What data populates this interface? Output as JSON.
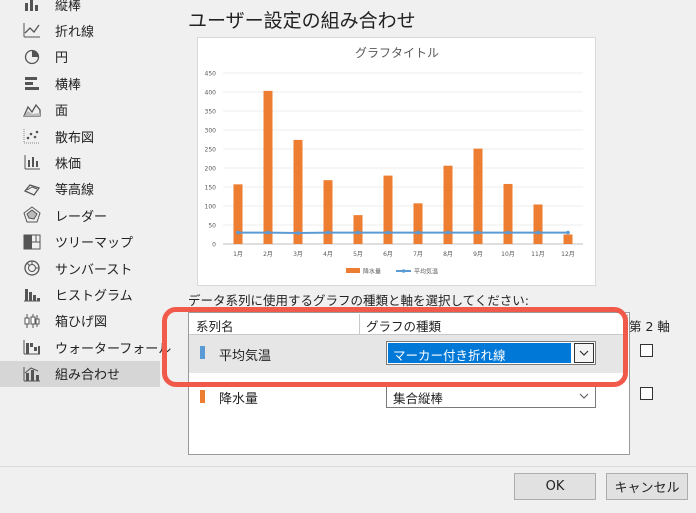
{
  "sidebar": {
    "items": [
      {
        "label": "縦棒",
        "icon": "column-chart-icon"
      },
      {
        "label": "折れ線",
        "icon": "line-chart-icon"
      },
      {
        "label": "円",
        "icon": "pie-chart-icon"
      },
      {
        "label": "横棒",
        "icon": "bar-chart-icon"
      },
      {
        "label": "面",
        "icon": "area-chart-icon"
      },
      {
        "label": "散布図",
        "icon": "scatter-chart-icon"
      },
      {
        "label": "株価",
        "icon": "stock-chart-icon"
      },
      {
        "label": "等高線",
        "icon": "surface-chart-icon"
      },
      {
        "label": "レーダー",
        "icon": "radar-chart-icon"
      },
      {
        "label": "ツリーマップ",
        "icon": "treemap-chart-icon"
      },
      {
        "label": "サンバースト",
        "icon": "sunburst-chart-icon"
      },
      {
        "label": "ヒストグラム",
        "icon": "histogram-chart-icon"
      },
      {
        "label": "箱ひげ図",
        "icon": "box-whisker-chart-icon"
      },
      {
        "label": "ウォーターフォール",
        "icon": "waterfall-chart-icon"
      },
      {
        "label": "組み合わせ",
        "icon": "combo-chart-icon",
        "selected": true
      }
    ]
  },
  "main": {
    "heading": "ユーザー設定の組み合わせ",
    "instruction": "データ系列に使用するグラフの種類と軸を選択してください:"
  },
  "chart_data": {
    "type": "bar",
    "title": "グラフタイトル",
    "categories": [
      "1月",
      "2月",
      "3月",
      "4月",
      "5月",
      "6月",
      "7月",
      "8月",
      "9月",
      "10月",
      "11月",
      "12月"
    ],
    "ylim": [
      0,
      450
    ],
    "yticks": [
      "0",
      "50",
      "100",
      "150",
      "200",
      "250",
      "300",
      "350",
      "400",
      "450"
    ],
    "legend_position": "bottom",
    "series": [
      {
        "name": "降水量",
        "type": "bar",
        "color": "#ed7d31",
        "values": [
          157,
          403,
          274,
          168,
          76,
          180,
          107,
          206,
          251,
          158,
          104,
          25
        ]
      },
      {
        "name": "平均気温",
        "type": "line-marker",
        "color": "#5b9bd5",
        "values": [
          30,
          30,
          29,
          30,
          30,
          30,
          30,
          30,
          30,
          30,
          30,
          30
        ]
      }
    ]
  },
  "table": {
    "headers": {
      "name": "系列名",
      "type": "グラフの種類",
      "axis": "第 2 軸"
    },
    "rows": [
      {
        "name": "平均気温",
        "marker_color": "#5b9bd5",
        "type": "マーカー付き折れ線",
        "secondary": false,
        "active": true
      },
      {
        "name": "降水量",
        "marker_color": "#ed7d31",
        "type": "集合縦棒",
        "secondary": false,
        "active": false
      }
    ]
  },
  "buttons": {
    "ok": "OK",
    "cancel": "キャンセル"
  },
  "colors": {
    "accent": "#0078d7",
    "highlight_ring": "#f15a4a"
  }
}
